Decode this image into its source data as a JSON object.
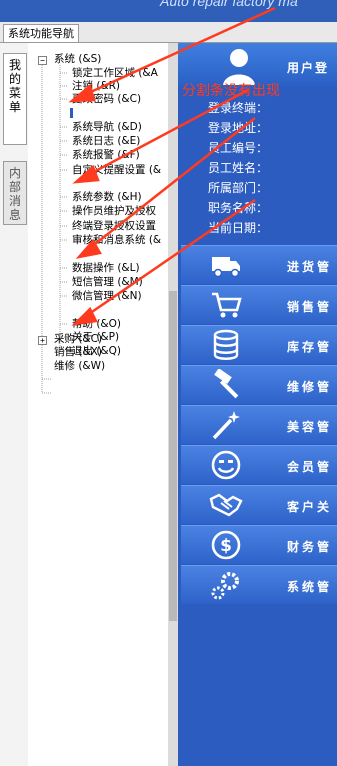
{
  "top_banner": {
    "text": "Auto repair factory ma"
  },
  "tab": {
    "label": "系统功能导航"
  },
  "side_tabs": {
    "active": "我的菜单",
    "inactive": "内部消息"
  },
  "tree": {
    "system": "系统 (&S)",
    "items": [
      "锁定工作区域 (&A",
      "注销 (&R)",
      "更改密码 (&C)",
      "系统导航 (&D)",
      "系统日志 (&E)",
      "系统报警 (&F)",
      "自定义提醒设置 (&",
      "系统参数 (&H)",
      "操作员维护及授权",
      "终端登录授权设置",
      "审核和消息系统 (&",
      "数据操作 (&L)",
      "短信管理 (&M)",
      "微信管理 (&N)",
      "帮助 (&O)",
      "关于 (&P)",
      "退出 (&Q)"
    ],
    "purchase": "采购 (&C)",
    "sales": "销售 (&X)",
    "repair": "维修 (&W)"
  },
  "user_panel": {
    "title": "用户登",
    "fields": [
      "登录终端：",
      "登录地址：",
      "员工编号：",
      "员工姓名：",
      "所属部门：",
      "职务名称：",
      "当前日期："
    ]
  },
  "menu": [
    {
      "label": "进货管",
      "icon": "truck-icon"
    },
    {
      "label": "销售管",
      "icon": "cart-icon"
    },
    {
      "label": "库存管",
      "icon": "database-icon"
    },
    {
      "label": "维修管",
      "icon": "hammer-icon"
    },
    {
      "label": "美容管",
      "icon": "magic-wand-icon"
    },
    {
      "label": "会员管",
      "icon": "smiley-icon"
    },
    {
      "label": "客户关",
      "icon": "handshake-icon"
    },
    {
      "label": "财务管",
      "icon": "dollar-icon"
    },
    {
      "label": "系统管",
      "icon": "gears-icon"
    }
  ],
  "annotation": "分割条没有出现",
  "colors": {
    "accent": "#2d5cc0",
    "annotation": "#ff3b1f"
  }
}
